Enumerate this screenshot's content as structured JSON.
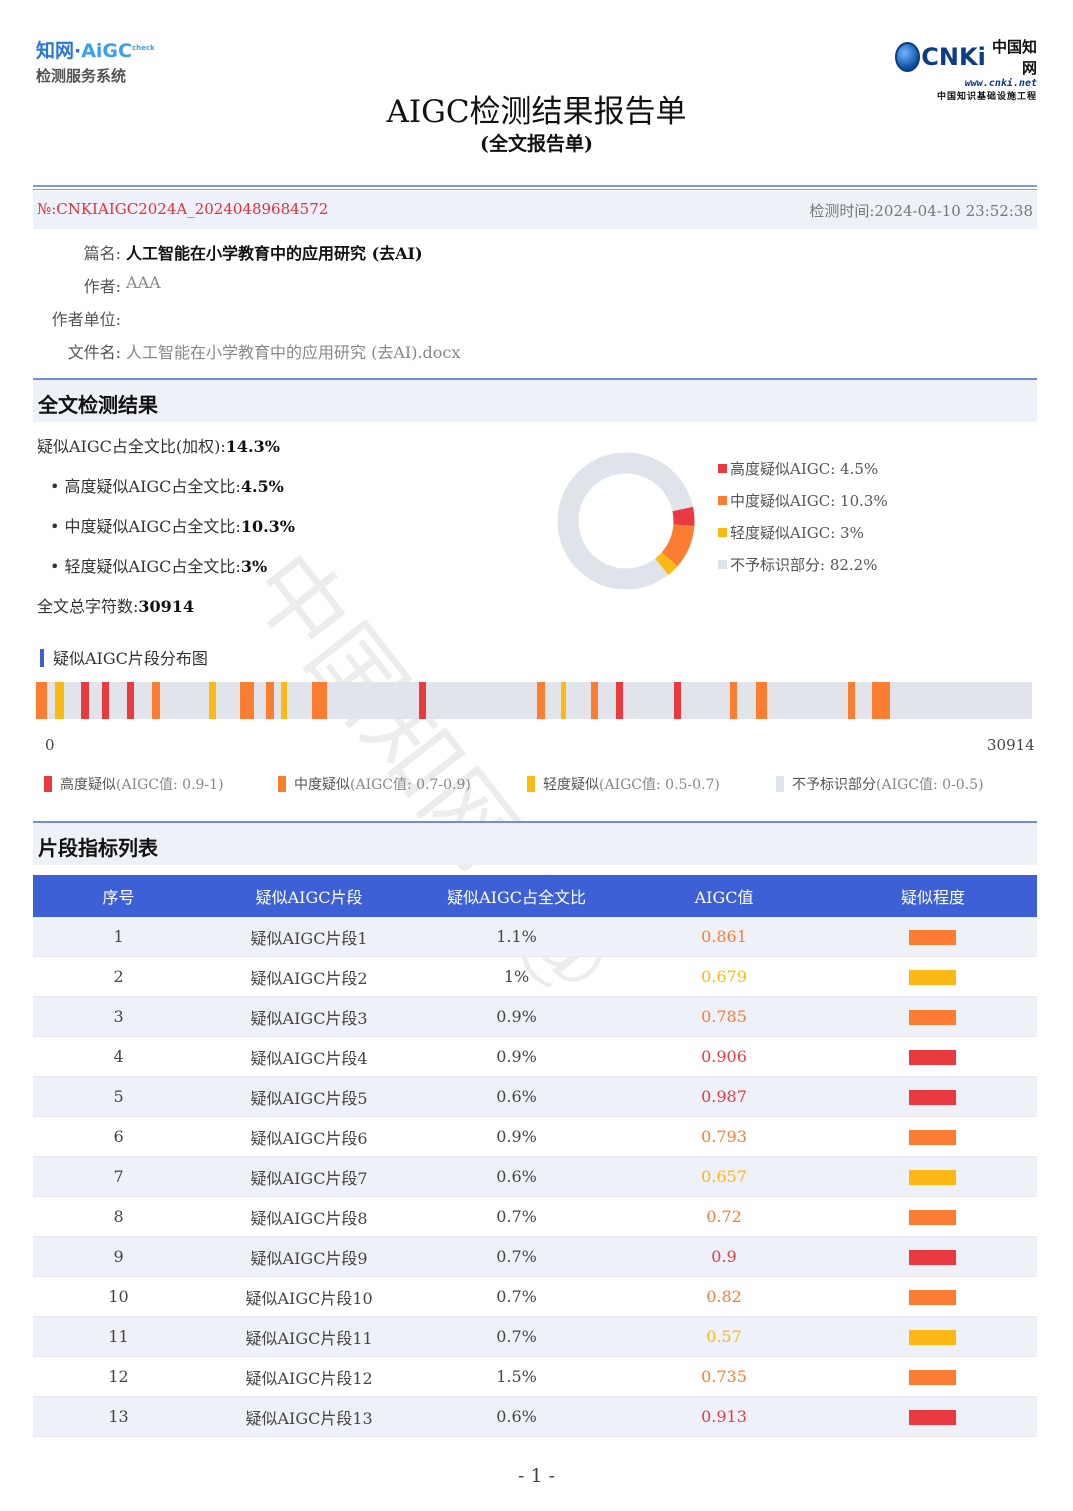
{
  "header": {
    "left_logo_line1_a": "知网·",
    "left_logo_line1_b": "AiGC",
    "left_logo_line1_check": "check",
    "left_logo_line2": "检测服务系统",
    "right_logo_cnki": "CNKi",
    "right_logo_cn": "中国知网",
    "right_logo_url": "www.cnki.net",
    "right_logo_tagline": "中国知识基础设施工程"
  },
  "title": "AIGC检测结果报告单",
  "subtitle": "(全文报告单)",
  "meta": {
    "report_no": "№:CNKIAIGC2024A_20240489684572",
    "check_time": "检测时间:2024-04-10 23:52:38"
  },
  "info": {
    "title_key": "篇名:",
    "title_val": "人工智能在小学教育中的应用研究 (去AI)",
    "author_key": "作者:",
    "author_val": "AAA",
    "unit_key": "作者单位:",
    "unit_val": "",
    "file_key": "文件名:",
    "file_val": "人工智能在小学教育中的应用研究 (去AI).docx"
  },
  "result": {
    "heading": "全文检测结果",
    "weighted_label": "疑似AIGC占全文比(加权):",
    "weighted_value": "14.3%",
    "high_label": "• 高度疑似AIGC占全文比:",
    "high_value": "4.5%",
    "mid_label": "• 中度疑似AIGC占全文比:",
    "mid_value": "10.3%",
    "low_label": "• 轻度疑似AIGC占全文比:",
    "low_value": "3%",
    "total_label": "全文总字符数:",
    "total_value": "30914"
  },
  "chart_data": {
    "type": "pie",
    "donut": true,
    "slices": [
      {
        "label": "高度疑似AIGC: 4.5%",
        "value": 4.5,
        "color": "#e83a3f"
      },
      {
        "label": "中度疑似AIGC: 10.3%",
        "value": 10.3,
        "color": "#fb7d31"
      },
      {
        "label": "轻度疑似AIGC: 3%",
        "value": 3,
        "color": "#fcb814"
      },
      {
        "label": "不予标识部分: 82.2%",
        "value": 82.2,
        "color": "#dfe3ea"
      }
    ],
    "legend_position": "right"
  },
  "distribution": {
    "title": "疑似AIGC片段分布图",
    "total_chars": 30914,
    "axis_start": "0",
    "axis_end": "30914",
    "segments": [
      {
        "start": 0,
        "end": 350,
        "level": "mid"
      },
      {
        "start": 580,
        "end": 870,
        "level": "low"
      },
      {
        "start": 1400,
        "end": 1650,
        "level": "high"
      },
      {
        "start": 2050,
        "end": 2280,
        "level": "high"
      },
      {
        "start": 2820,
        "end": 3040,
        "level": "high"
      },
      {
        "start": 3610,
        "end": 3850,
        "level": "mid"
      },
      {
        "start": 5360,
        "end": 5580,
        "level": "low"
      },
      {
        "start": 6330,
        "end": 6760,
        "level": "mid"
      },
      {
        "start": 7140,
        "end": 7380,
        "level": "mid"
      },
      {
        "start": 7590,
        "end": 7780,
        "level": "low"
      },
      {
        "start": 8560,
        "end": 9030,
        "level": "mid"
      },
      {
        "start": 11880,
        "end": 12100,
        "level": "high"
      },
      {
        "start": 15560,
        "end": 15790,
        "level": "mid"
      },
      {
        "start": 16300,
        "end": 16460,
        "level": "low"
      },
      {
        "start": 17230,
        "end": 17450,
        "level": "mid"
      },
      {
        "start": 18000,
        "end": 18210,
        "level": "high"
      },
      {
        "start": 19810,
        "end": 20030,
        "level": "high"
      },
      {
        "start": 21550,
        "end": 21760,
        "level": "mid"
      },
      {
        "start": 22340,
        "end": 22680,
        "level": "mid"
      },
      {
        "start": 25210,
        "end": 25430,
        "level": "mid"
      },
      {
        "start": 25950,
        "end": 26520,
        "level": "mid"
      }
    ],
    "legend": [
      {
        "name": "高度疑似",
        "range": "(AIGC值: 0.9-1)",
        "color": "#e83a3f"
      },
      {
        "name": "中度疑似",
        "range": "(AIGC值: 0.7-0.9)",
        "color": "#fb7d31"
      },
      {
        "name": "轻度疑似",
        "range": "(AIGC值: 0.5-0.7)",
        "color": "#fcb814"
      },
      {
        "name": "不予标识部分",
        "range": "(AIGC值: 0-0.5)",
        "color": "#dfe3ea"
      }
    ]
  },
  "table": {
    "heading": "片段指标列表",
    "columns": [
      "序号",
      "疑似AIGC片段",
      "疑似AIGC占全文比",
      "AIGC值",
      "疑似程度"
    ],
    "rows": [
      {
        "no": "1",
        "name": "疑似AIGC片段1",
        "ratio": "1.1%",
        "value": "0.861",
        "level": "mid"
      },
      {
        "no": "2",
        "name": "疑似AIGC片段2",
        "ratio": "1%",
        "value": "0.679",
        "level": "low"
      },
      {
        "no": "3",
        "name": "疑似AIGC片段3",
        "ratio": "0.9%",
        "value": "0.785",
        "level": "mid"
      },
      {
        "no": "4",
        "name": "疑似AIGC片段4",
        "ratio": "0.9%",
        "value": "0.906",
        "level": "high"
      },
      {
        "no": "5",
        "name": "疑似AIGC片段5",
        "ratio": "0.6%",
        "value": "0.987",
        "level": "high"
      },
      {
        "no": "6",
        "name": "疑似AIGC片段6",
        "ratio": "0.9%",
        "value": "0.793",
        "level": "mid"
      },
      {
        "no": "7",
        "name": "疑似AIGC片段7",
        "ratio": "0.6%",
        "value": "0.657",
        "level": "low"
      },
      {
        "no": "8",
        "name": "疑似AIGC片段8",
        "ratio": "0.7%",
        "value": "0.72",
        "level": "mid"
      },
      {
        "no": "9",
        "name": "疑似AIGC片段9",
        "ratio": "0.7%",
        "value": "0.9",
        "level": "high"
      },
      {
        "no": "10",
        "name": "疑似AIGC片段10",
        "ratio": "0.7%",
        "value": "0.82",
        "level": "mid"
      },
      {
        "no": "11",
        "name": "疑似AIGC片段11",
        "ratio": "0.7%",
        "value": "0.57",
        "level": "low"
      },
      {
        "no": "12",
        "name": "疑似AIGC片段12",
        "ratio": "1.5%",
        "value": "0.735",
        "level": "mid"
      },
      {
        "no": "13",
        "name": "疑似AIGC片段13",
        "ratio": "0.6%",
        "value": "0.913",
        "level": "high"
      }
    ]
  },
  "level_colors": {
    "high": "#e83a3f",
    "mid": "#fb7d31",
    "low": "#fcb814"
  },
  "watermark": "中国知网 (@",
  "page_number": "- 1 -"
}
